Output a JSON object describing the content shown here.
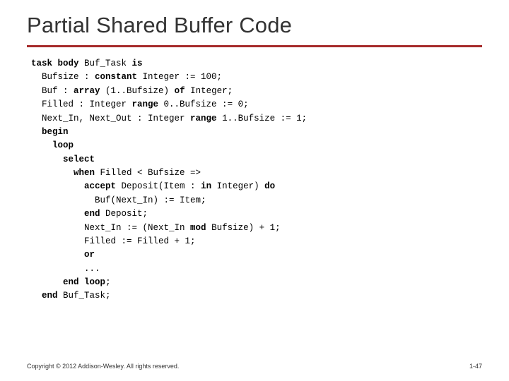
{
  "title": "Partial Shared Buffer Code",
  "code": {
    "l1a": "task body",
    "l1b": " Buf_Task ",
    "l1c": "is",
    "l2a": "  Bufsize : ",
    "l2b": "constant",
    "l2c": " Integer := 100;",
    "l3a": "  Buf : ",
    "l3b": "array",
    "l3c": " (1..Bufsize) ",
    "l3d": "of",
    "l3e": " Integer;",
    "l4a": "  Filled : Integer ",
    "l4b": "range",
    "l4c": " 0..Bufsize := 0;",
    "l5a": "  Next_In, Next_Out : Integer ",
    "l5b": "range",
    "l5c": " 1..Bufsize := 1;",
    "l6": "  begin",
    "l7": "    loop",
    "l8": "      select",
    "l9a": "        ",
    "l9b": "when",
    "l9c": " Filled < Bufsize =>",
    "l10a": "          ",
    "l10b": "accept",
    "l10c": " Deposit(Item : ",
    "l10d": "in",
    "l10e": " Integer) ",
    "l10f": "do",
    "l11": "            Buf(Next_In) := Item;",
    "l12a": "          ",
    "l12b": "end",
    "l12c": " Deposit;",
    "l13a": "          Next_In := (Next_In ",
    "l13b": "mod",
    "l13c": " Bufsize) + 1;",
    "l14": "          Filled := Filled + 1;",
    "l15": "          or",
    "l16": "          ...",
    "l17a": "      ",
    "l17b": "end",
    "l17c": " ",
    "l17d": "loop",
    "l17e": ";",
    "l18a": "  ",
    "l18b": "end",
    "l18c": " Buf_Task;"
  },
  "footer": "Copyright © 2012 Addison-Wesley. All rights reserved.",
  "pagenum": "1-47"
}
